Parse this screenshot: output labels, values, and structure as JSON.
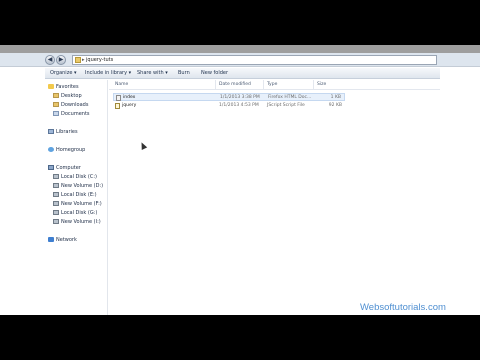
{
  "address": {
    "path": "jquery-tuts",
    "separator": "▸"
  },
  "toolbar": {
    "organize": "Organize ▾",
    "include": "Include in library ▾",
    "share": "Share with ▾",
    "burn": "Burn",
    "new_folder": "New folder"
  },
  "nav": {
    "favorites": {
      "header": "Favorites",
      "items": [
        "Desktop",
        "Downloads",
        "Documents"
      ]
    },
    "libraries": "Libraries",
    "homegroup": "Homegroup",
    "computer": {
      "header": "Computer",
      "items": [
        "Local Disk (C:)",
        "New Volume (D:)",
        "Local Disk (E:)",
        "New Volume (F:)",
        "Local Disk (G:)",
        "New Volume (I:)"
      ]
    },
    "network": "Network"
  },
  "columns": {
    "name": "Name",
    "date": "Date modified",
    "type": "Type",
    "size": "Size"
  },
  "files": [
    {
      "name": "index",
      "date": "1/1/2013 3:38 PM",
      "type": "Firefox HTML Doc...",
      "size": "1 KB"
    },
    {
      "name": "jquery",
      "date": "1/1/2013 4:53 PM",
      "type": "JScript Script File",
      "size": "92 KB"
    }
  ],
  "watermark": "Websoftutorials.com",
  "colors": {
    "accent": "#4f8fd1",
    "toolbar_bg": "#dfe6ee",
    "selection": "#e7f0fb"
  }
}
